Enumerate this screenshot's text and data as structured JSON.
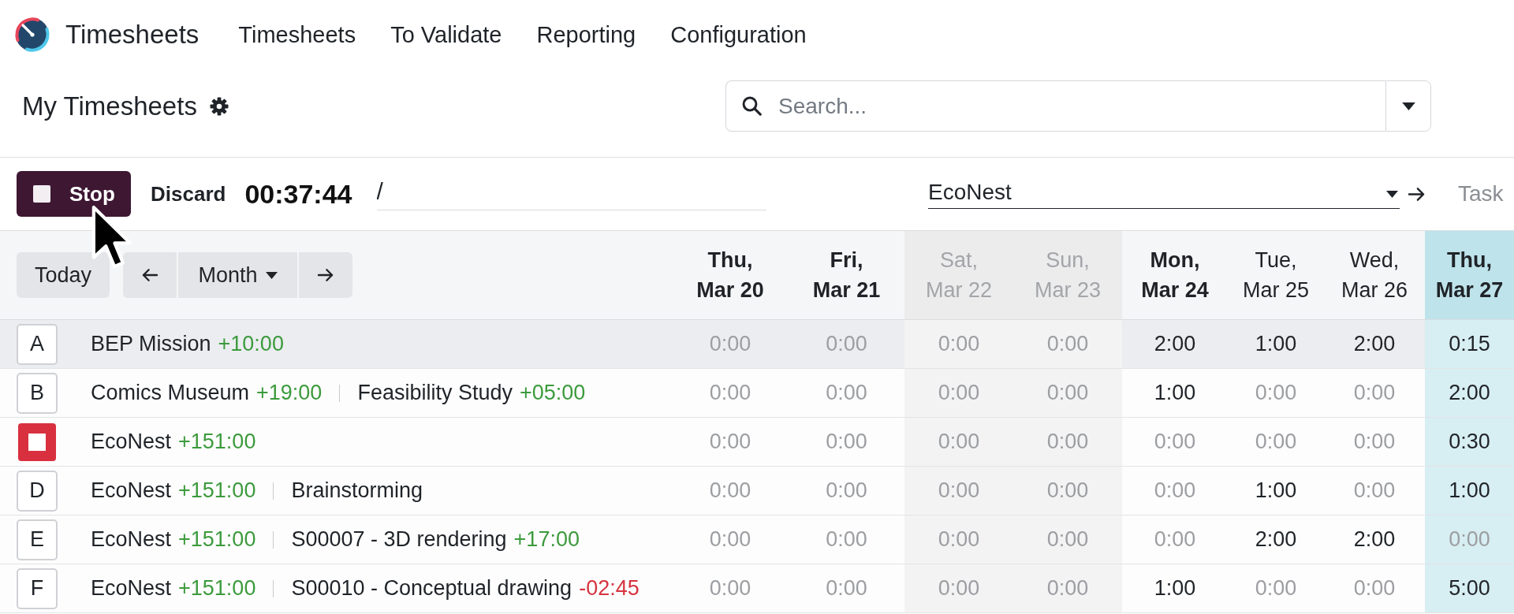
{
  "app": {
    "name": "Timesheets",
    "menu": [
      "Timesheets",
      "To Validate",
      "Reporting",
      "Configuration"
    ]
  },
  "control_panel": {
    "title": "My Timesheets",
    "search": {
      "placeholder": "Search..."
    }
  },
  "timer": {
    "stop_label": "Stop",
    "discard_label": "Discard",
    "elapsed": "00:37:44",
    "description": {
      "value": "/"
    },
    "project": {
      "value": "EcoNest"
    },
    "task": {
      "placeholder": "Task"
    }
  },
  "grid": {
    "today_label": "Today",
    "range_label": "Month",
    "columns": [
      {
        "day": "Thu,",
        "date": "Mar 20",
        "bold": true,
        "weekend": false,
        "today": false
      },
      {
        "day": "Fri,",
        "date": "Mar 21",
        "bold": true,
        "weekend": false,
        "today": false
      },
      {
        "day": "Sat,",
        "date": "Mar 22",
        "bold": false,
        "weekend": true,
        "today": false
      },
      {
        "day": "Sun,",
        "date": "Mar 23",
        "bold": false,
        "weekend": true,
        "today": false
      },
      {
        "day": "Mon,",
        "date": "Mar 24",
        "bold": true,
        "weekend": false,
        "today": false
      },
      {
        "day": "Tue,",
        "date": "Mar 25",
        "bold": false,
        "weekend": false,
        "today": false
      },
      {
        "day": "Wed,",
        "date": "Mar 26",
        "bold": false,
        "weekend": false,
        "today": false
      },
      {
        "day": "Thu,",
        "date": "Mar 27",
        "bold": true,
        "weekend": false,
        "today": true
      }
    ],
    "rows": [
      {
        "badge": {
          "kind": "key",
          "label": "A"
        },
        "hovered": true,
        "project": "BEP Mission",
        "project_hours": {
          "text": "+10:00",
          "color": "#3c9a3c"
        },
        "cells": [
          {
            "text": "0:00",
            "dim": true
          },
          {
            "text": "0:00",
            "dim": true
          },
          {
            "text": "0:00",
            "dim": true
          },
          {
            "text": "0:00",
            "dim": true
          },
          {
            "text": "2:00",
            "dim": false
          },
          {
            "text": "1:00",
            "dim": false
          },
          {
            "text": "2:00",
            "dim": false
          },
          {
            "text": "0:15",
            "dim": false
          }
        ]
      },
      {
        "badge": {
          "kind": "key",
          "label": "B"
        },
        "hovered": false,
        "project": "Comics Museum",
        "project_hours": {
          "text": "+19:00",
          "color": "#3c9a3c"
        },
        "task": "Feasibility Study",
        "task_hours": {
          "text": "+05:00",
          "color": "#3c9a3c"
        },
        "cells": [
          {
            "text": "0:00",
            "dim": true
          },
          {
            "text": "0:00",
            "dim": true
          },
          {
            "text": "0:00",
            "dim": true
          },
          {
            "text": "0:00",
            "dim": true
          },
          {
            "text": "1:00",
            "dim": false
          },
          {
            "text": "0:00",
            "dim": true
          },
          {
            "text": "0:00",
            "dim": true
          },
          {
            "text": "2:00",
            "dim": false
          }
        ]
      },
      {
        "badge": {
          "kind": "running"
        },
        "hovered": false,
        "project": "EcoNest",
        "project_hours": {
          "text": "+151:00",
          "color": "#3c9a3c"
        },
        "cells": [
          {
            "text": "0:00",
            "dim": true
          },
          {
            "text": "0:00",
            "dim": true
          },
          {
            "text": "0:00",
            "dim": true
          },
          {
            "text": "0:00",
            "dim": true
          },
          {
            "text": "0:00",
            "dim": true
          },
          {
            "text": "0:00",
            "dim": true
          },
          {
            "text": "0:00",
            "dim": true
          },
          {
            "text": "0:30",
            "dim": false
          }
        ]
      },
      {
        "badge": {
          "kind": "key",
          "label": "D"
        },
        "hovered": false,
        "project": "EcoNest",
        "project_hours": {
          "text": "+151:00",
          "color": "#3c9a3c"
        },
        "task": "Brainstorming",
        "cells": [
          {
            "text": "0:00",
            "dim": true
          },
          {
            "text": "0:00",
            "dim": true
          },
          {
            "text": "0:00",
            "dim": true
          },
          {
            "text": "0:00",
            "dim": true
          },
          {
            "text": "0:00",
            "dim": true
          },
          {
            "text": "1:00",
            "dim": false
          },
          {
            "text": "0:00",
            "dim": true
          },
          {
            "text": "1:00",
            "dim": false
          }
        ]
      },
      {
        "badge": {
          "kind": "key",
          "label": "E"
        },
        "hovered": false,
        "project": "EcoNest",
        "project_hours": {
          "text": "+151:00",
          "color": "#3c9a3c"
        },
        "task": "S00007 - 3D rendering",
        "task_hours": {
          "text": "+17:00",
          "color": "#3c9a3c"
        },
        "cells": [
          {
            "text": "0:00",
            "dim": true
          },
          {
            "text": "0:00",
            "dim": true
          },
          {
            "text": "0:00",
            "dim": true
          },
          {
            "text": "0:00",
            "dim": true
          },
          {
            "text": "0:00",
            "dim": true
          },
          {
            "text": "2:00",
            "dim": false
          },
          {
            "text": "2:00",
            "dim": false
          },
          {
            "text": "0:00",
            "dim": true
          }
        ]
      },
      {
        "badge": {
          "kind": "key",
          "label": "F"
        },
        "hovered": false,
        "project": "EcoNest",
        "project_hours": {
          "text": "+151:00",
          "color": "#3c9a3c"
        },
        "task": "S00010 - Conceptual drawing",
        "task_hours": {
          "text": "-02:45",
          "color": "#d63340"
        },
        "cells": [
          {
            "text": "0:00",
            "dim": true
          },
          {
            "text": "0:00",
            "dim": true
          },
          {
            "text": "0:00",
            "dim": true
          },
          {
            "text": "0:00",
            "dim": true
          },
          {
            "text": "1:00",
            "dim": false
          },
          {
            "text": "0:00",
            "dim": true
          },
          {
            "text": "0:00",
            "dim": true
          },
          {
            "text": "5:00",
            "dim": false
          }
        ]
      }
    ]
  }
}
